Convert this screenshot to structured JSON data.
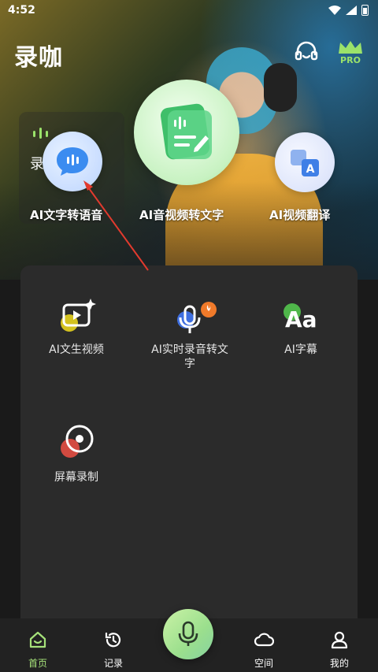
{
  "status_bar": {
    "time": "4:52"
  },
  "app": {
    "title": "录咖",
    "pro_label": "PRO"
  },
  "feature_card": {
    "partial_label": "录"
  },
  "features": [
    {
      "label": "AI文字转语音",
      "icon": "speech-bubble-icon"
    },
    {
      "label": "AI音视频转文字",
      "icon": "transcript-icon"
    },
    {
      "label": "AI视频翻译",
      "icon": "translate-icon"
    }
  ],
  "tools": [
    {
      "label": "AI文生视频",
      "icon": "video-spark-icon"
    },
    {
      "label": "AI实时录音转文字",
      "icon": "mic-icon"
    },
    {
      "label": "AI字幕",
      "icon": "subtitle-icon",
      "glyph": "Aa"
    },
    {
      "label": "屏幕录制",
      "icon": "record-icon"
    }
  ],
  "bottom_nav": [
    {
      "label": "首页",
      "icon": "home-icon",
      "active": true
    },
    {
      "label": "记录",
      "icon": "history-icon"
    },
    {
      "label": "空间",
      "icon": "cloud-icon"
    },
    {
      "label": "我的",
      "icon": "profile-icon"
    }
  ],
  "colors": {
    "accent": "#a6e27a",
    "panel": "#2b2b2b",
    "annotation": "#e23a2e"
  }
}
